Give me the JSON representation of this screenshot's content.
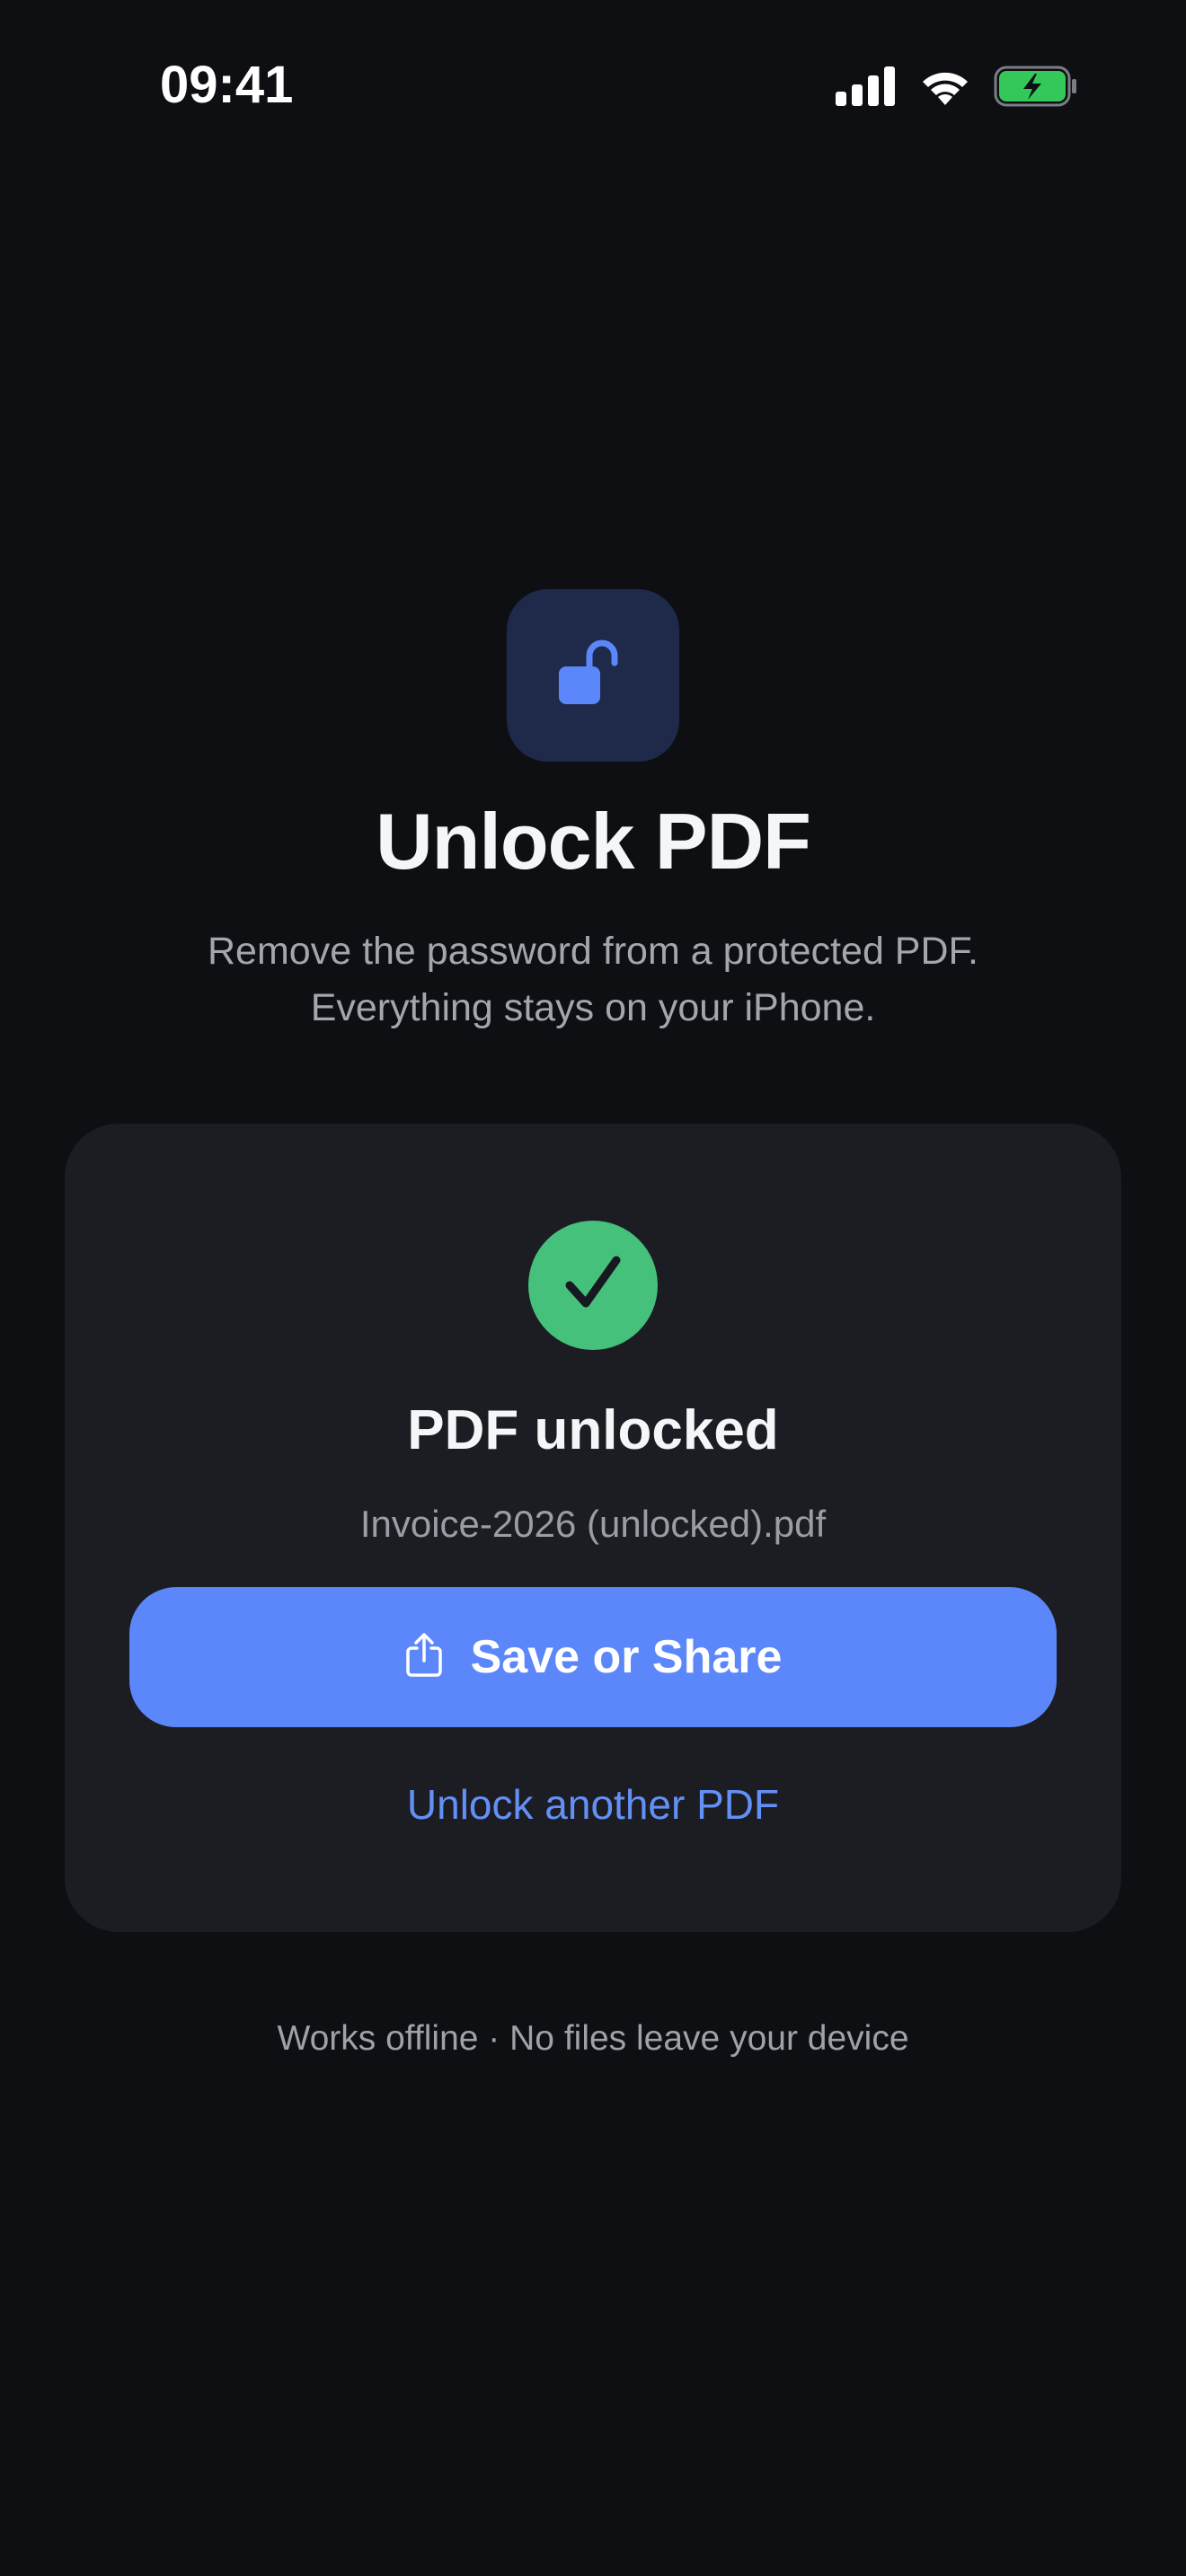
{
  "status_bar": {
    "time": "09:41",
    "icons": [
      "cellular-signal-icon",
      "wifi-icon",
      "battery-charging-icon"
    ],
    "battery_color": "#34c759"
  },
  "header": {
    "icon": "lock-open-icon",
    "title": "Unlock PDF",
    "subtitle_line1": "Remove the password from a protected PDF.",
    "subtitle_line2": "Everything stays on your iPhone."
  },
  "result_card": {
    "status_icon": "checkmark-icon",
    "title": "PDF unlocked",
    "filename": "Invoice-2026 (unlocked).pdf",
    "primary_button": {
      "icon": "share-icon",
      "label": "Save or Share"
    },
    "secondary_link": "Unlock another PDF"
  },
  "footer": {
    "note": "Works offline · No files leave your device"
  },
  "colors": {
    "background": "#0d0f13",
    "card": "#1c1d22",
    "accent": "#5c87fa",
    "success": "#45c17c",
    "icon_tile": "#1f2a4a"
  }
}
